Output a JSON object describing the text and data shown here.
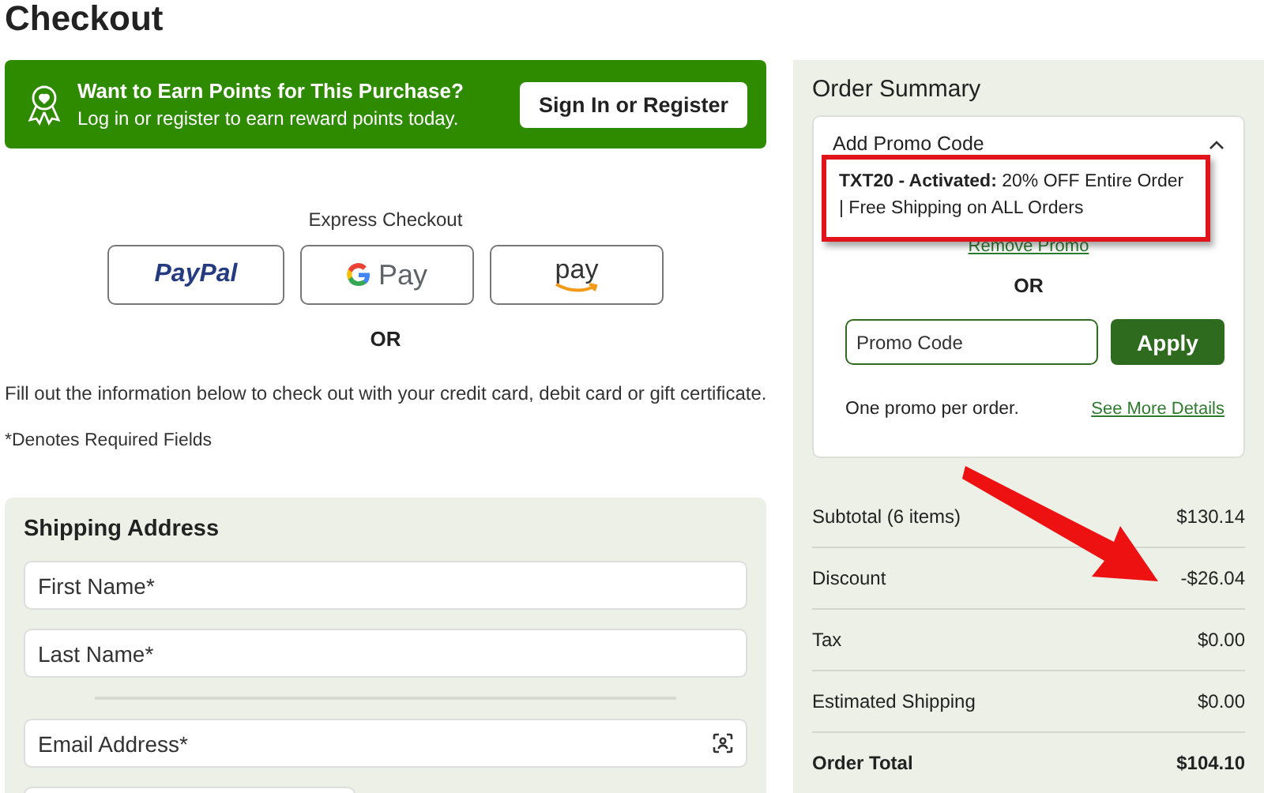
{
  "page_title": "Checkout",
  "rewards_banner": {
    "title": "Want to Earn Points for This Purchase?",
    "subtitle": "Log in or register to earn reward points today.",
    "button": "Sign In or Register"
  },
  "express_checkout": {
    "label": "Express Checkout",
    "buttons": [
      {
        "kind": "paypal",
        "label": "PayPal"
      },
      {
        "kind": "gpay",
        "label": "Pay"
      },
      {
        "kind": "amazon",
        "label": "pay"
      }
    ],
    "separator": "OR"
  },
  "instructions": "Fill out the information below to check out with your credit card, debit card or gift certificate.",
  "required_note": "*Denotes Required Fields",
  "shipping": {
    "title": "Shipping Address",
    "fields": [
      {
        "kind": "text",
        "placeholder": "First Name*"
      },
      {
        "kind": "text",
        "placeholder": "Last Name*"
      },
      {
        "kind": "divider"
      },
      {
        "kind": "email",
        "placeholder": "Email Address*"
      },
      {
        "kind": "half"
      }
    ]
  },
  "order_summary": {
    "title": "Order Summary",
    "promo": {
      "title": "Add Promo Code",
      "expanded": true,
      "message": "**TXT20 - Activated:** 20% OFF Entire Order | Free Shipping on ALL Orders",
      "remove_link": "Remove Promo",
      "separator": "OR",
      "field_placeholder": "Promo Code",
      "apply_button": "Apply",
      "note": "One promo per order.",
      "details_link": "See More Details"
    },
    "rows": [
      {
        "label": "Subtotal (6 items)",
        "value": "$130.14",
        "kind": "line"
      },
      {
        "label": "Discount",
        "value": "-$26.04",
        "kind": "line"
      },
      {
        "label": "Tax",
        "value": "$0.00",
        "kind": "line"
      },
      {
        "label": "Estimated Shipping",
        "value": "$0.00",
        "kind": "line"
      },
      {
        "label": "Order Total",
        "value": "$104.10",
        "kind": "total"
      }
    ]
  }
}
